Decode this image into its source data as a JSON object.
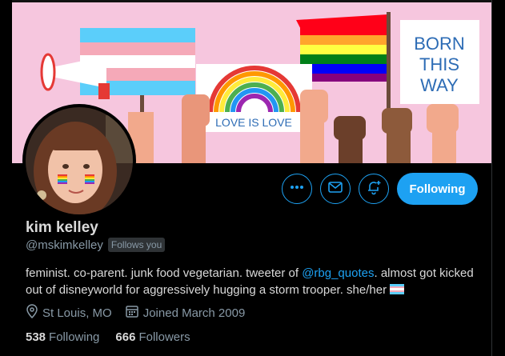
{
  "banner": {
    "sign_left_text": "LOVE IS LOVE",
    "sign_right_text": [
      "BORN",
      "THIS",
      "WAY"
    ]
  },
  "profile": {
    "display_name": "kim kelley",
    "handle": "@mskimkelley",
    "follows_you": "Follows you",
    "bio_before": "feminist. co-parent. junk food vegetarian. tweeter of ",
    "bio_mention": "@rbg_quotes",
    "bio_after": ". almost got kicked out of disneyworld for aggressively hugging a storm trooper. she/her",
    "location": "St Louis, MO",
    "joined": "Joined March 2009",
    "following_count": "538",
    "following_label": "Following",
    "followers_count": "666",
    "followers_label": "Followers"
  },
  "actions": {
    "more_icon": "more-icon",
    "message_icon": "mail-icon",
    "notify_icon": "bell-plus-icon",
    "follow_label": "Following"
  },
  "colors": {
    "accent": "#1da1f2",
    "background": "#000000",
    "text": "#d9d9d9",
    "muted": "#8899a6"
  }
}
